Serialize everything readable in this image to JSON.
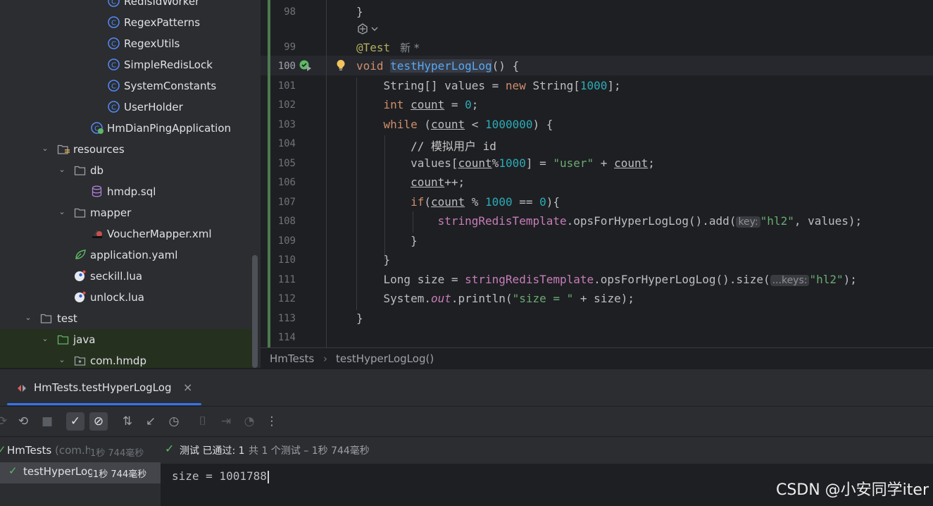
{
  "tree": {
    "items": [
      {
        "label": "RedisIdWorker",
        "kind": "class"
      },
      {
        "label": "RegexPatterns",
        "kind": "class"
      },
      {
        "label": "RegexUtils",
        "kind": "class"
      },
      {
        "label": "SimpleRedisLock",
        "kind": "class"
      },
      {
        "label": "SystemConstants",
        "kind": "class"
      },
      {
        "label": "UserHolder",
        "kind": "class"
      },
      {
        "label": "HmDianPingApplication",
        "kind": "app"
      },
      {
        "label": "resources",
        "kind": "folder"
      },
      {
        "label": "db",
        "kind": "folder"
      },
      {
        "label": "hmdp.sql",
        "kind": "sql"
      },
      {
        "label": "mapper",
        "kind": "folder"
      },
      {
        "label": "VoucherMapper.xml",
        "kind": "xml"
      },
      {
        "label": "application.yaml",
        "kind": "yaml"
      },
      {
        "label": "seckill.lua",
        "kind": "lua"
      },
      {
        "label": "unlock.lua",
        "kind": "lua"
      },
      {
        "label": "test",
        "kind": "folder"
      },
      {
        "label": "java",
        "kind": "folder"
      },
      {
        "label": "com.hmdp",
        "kind": "package"
      }
    ]
  },
  "editor": {
    "line_numbers": [
      "98",
      "99",
      "100",
      "101",
      "102",
      "103",
      "104",
      "105",
      "106",
      "107",
      "108",
      "109",
      "110",
      "111",
      "112",
      "113",
      "114"
    ],
    "code_vision": "新 *",
    "annotation": "@Test",
    "method_name": "testHyperLogLog",
    "hint_key": "key:",
    "hint_keys": "...keys:",
    "comment": "// 模拟用户 id",
    "output_string": "\"size = \"",
    "user_string": "\"user\"",
    "hl2_string": "\"hl2\"",
    "num_1000": "1000",
    "num_0": "0",
    "num_1000000": "1000000"
  },
  "breadcrumb": {
    "file": "HmTests",
    "method": "testHyperLogLog()"
  },
  "run": {
    "tab_title": "HmTests.testHyperLogLog",
    "tree": [
      {
        "label": "HmTests",
        "detail": "(com.h",
        "time": "1秒 744毫秒"
      },
      {
        "label": "testHyperLog",
        "time": "1秒 744毫秒"
      }
    ],
    "status_main": "测试 已通过: 1",
    "status_detail": "共 1 个测试 – 1秒 744毫秒",
    "output": "size = 1001788"
  },
  "watermark": "CSDN @小安同学iter"
}
